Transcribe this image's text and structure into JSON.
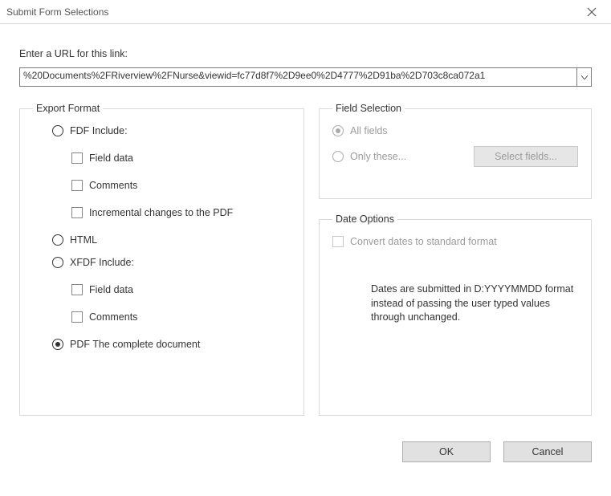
{
  "title": "Submit Form Selections",
  "url_label": "Enter a URL for this link:",
  "url_value": "%20Documents%2FRiverview%2FNurse&viewid=fc77d8f7%2D9ee0%2D4777%2D91ba%2D703c8ca072a1",
  "export": {
    "legend": "Export Format",
    "fdf": {
      "label": "FDF  Include:",
      "checked": false
    },
    "fdf_field_data": {
      "label": "Field data",
      "checked": false
    },
    "fdf_comments": {
      "label": "Comments",
      "checked": false
    },
    "fdf_incremental": {
      "label": "Incremental changes to the PDF",
      "checked": false
    },
    "html": {
      "label": "HTML",
      "checked": false
    },
    "xfdf": {
      "label": "XFDF  Include:",
      "checked": false
    },
    "xfdf_field_data": {
      "label": "Field data",
      "checked": false
    },
    "xfdf_comments": {
      "label": "Comments",
      "checked": false
    },
    "pdf": {
      "label": "PDF  The complete document",
      "checked": true
    }
  },
  "fieldsel": {
    "legend": "Field Selection",
    "all": {
      "label": "All fields",
      "checked": true,
      "disabled": true
    },
    "only": {
      "label": "Only these...",
      "checked": false,
      "disabled": true
    },
    "select_button": "Select fields..."
  },
  "dateopt": {
    "legend": "Date Options",
    "convert": {
      "label": "Convert dates to standard format",
      "checked": false,
      "disabled": true
    },
    "note": "Dates are submitted in D:YYYYMMDD format instead of passing the user typed values through unchanged."
  },
  "buttons": {
    "ok": "OK",
    "cancel": "Cancel"
  }
}
